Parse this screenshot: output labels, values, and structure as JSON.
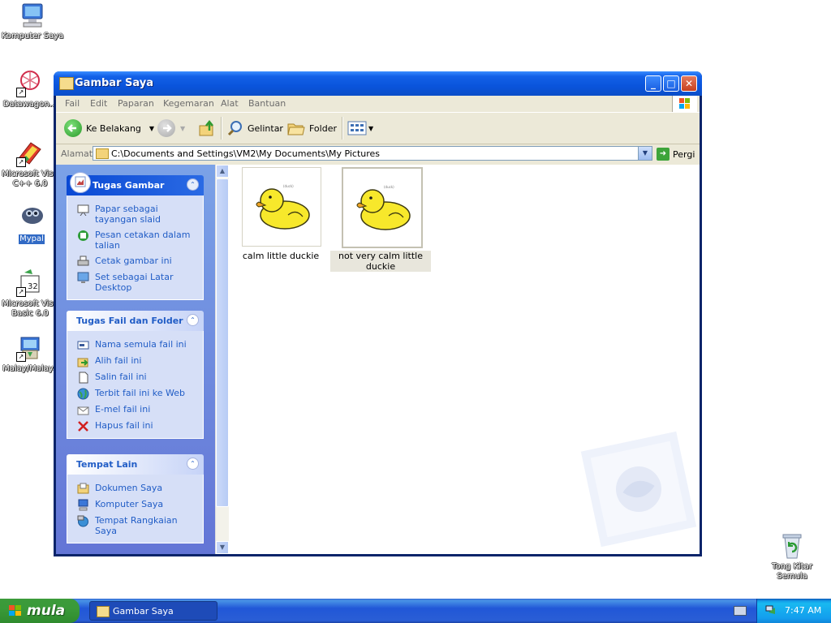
{
  "desktop": {
    "icons": [
      {
        "label": "Komputer Saya",
        "selected": false
      },
      {
        "label": "Datawagon...",
        "selected": false
      },
      {
        "label": "Microsoft Visu C++ 6.0",
        "selected": false
      },
      {
        "label": "Mypal",
        "selected": true
      },
      {
        "label": "Microsoft Visu Basic 6.0",
        "selected": false
      },
      {
        "label": "Malay/Malays",
        "selected": false
      },
      {
        "label": "Tong Kitar Semula",
        "selected": false
      }
    ]
  },
  "window": {
    "title": "Gambar Saya",
    "controls": {
      "minimize": "_",
      "maximize": "□",
      "close": "✕"
    }
  },
  "menu": {
    "items": [
      "Fail",
      "Edit",
      "Paparan",
      "Kegemaran",
      "Alat",
      "Bantuan"
    ]
  },
  "toolbar": {
    "back": "Ke Belakang",
    "search": "Gelintar",
    "folders": "Folder"
  },
  "address": {
    "label": "Alamat",
    "path": "C:\\Documents and Settings\\VM2\\My Documents\\My Pictures",
    "go": "Pergi"
  },
  "tasks": {
    "picture": {
      "title": "Tugas Gambar",
      "items": [
        "Papar sebagai tayangan slaid",
        "Pesan cetakan dalam talian",
        "Cetak gambar ini",
        "Set sebagai Latar Desktop"
      ]
    },
    "file": {
      "title": "Tugas Fail dan Folder",
      "items": [
        "Nama semula fail ini",
        "Alih fail ini",
        "Salin fail ini",
        "Terbit fail ini ke Web",
        "E-mel fail ini",
        "Hapus fail ini"
      ]
    },
    "other": {
      "title": "Tempat Lain",
      "items": [
        "Dokumen Saya",
        "Komputer Saya",
        "Tempat Rangkaian Saya"
      ]
    }
  },
  "files": [
    {
      "name": "calm little duckie",
      "caption": "(duck)",
      "selected": false
    },
    {
      "name": "not very calm little duckie",
      "caption": "(duck)",
      "selected": true
    }
  ],
  "taskbar": {
    "start": "mula",
    "active_window": "Gambar Saya",
    "clock": "7:47 AM"
  },
  "colors": {
    "titlebar": "#0a54dc",
    "taskpane": "#6f8cdf",
    "link": "#215dc6",
    "start_green": "#3a9a39",
    "duck_yellow": "#f7e82b"
  }
}
